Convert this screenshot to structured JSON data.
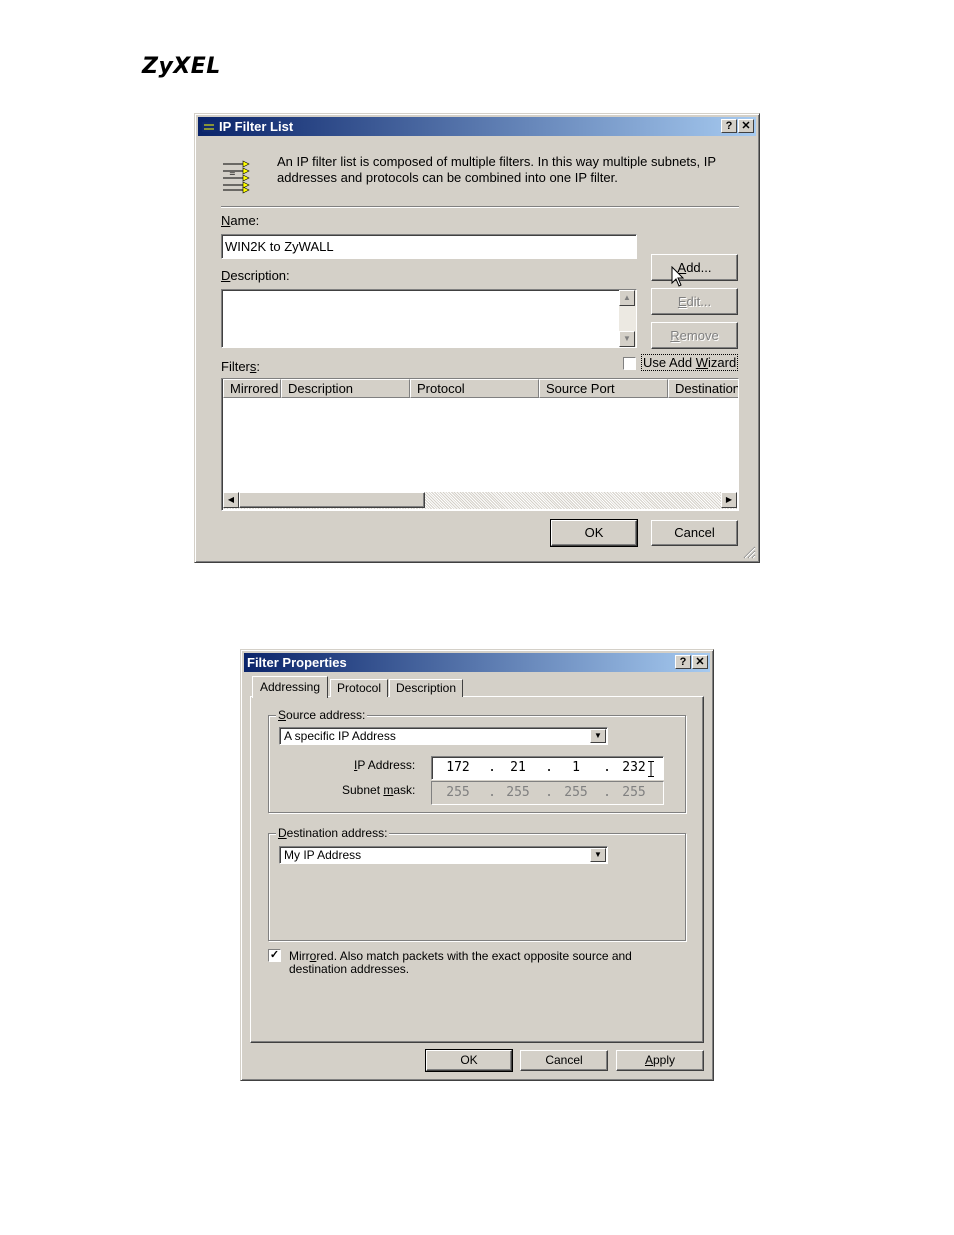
{
  "header": {
    "logo": "ZyXEL"
  },
  "ip_filter_list": {
    "title": "IP Filter List",
    "help_btn": "?",
    "close_btn": "✕",
    "intro": "An IP filter list is composed of multiple filters. In this way multiple subnets, IP addresses and protocols can be combined into one IP filter.",
    "name_label_u": "N",
    "name_label_rest": "ame:",
    "name_value": "WIN2K to ZyWALL",
    "desc_label_u": "D",
    "desc_label_rest": "escription:",
    "desc_value": "",
    "filters_label_a": "Filter",
    "filters_label_u": "s",
    "filters_label_b": ":",
    "add_btn_u": "A",
    "add_btn_rest": "dd...",
    "edit_btn_u": "E",
    "edit_btn_rest": "dit...",
    "remove_btn_u": "R",
    "remove_btn_rest": "emove",
    "wizard_label_a": "Use Add ",
    "wizard_label_u": "W",
    "wizard_label_b": "izard",
    "columns": [
      "Mirrored",
      "Description",
      "Protocol",
      "Source Port",
      "Destination"
    ],
    "ok_btn": "OK",
    "cancel_btn": "Cancel"
  },
  "filter_properties": {
    "title": "Filter Properties",
    "help_btn": "?",
    "close_btn": "✕",
    "tabs": [
      "Addressing",
      "Protocol",
      "Description"
    ],
    "source_legend_u": "S",
    "source_legend_rest": "ource address:",
    "source_value": "A specific IP Address",
    "ip_label_u": "I",
    "ip_label_rest": "P Address:",
    "ip_octets": [
      "172",
      "21",
      "1",
      "232"
    ],
    "mask_label_a": "Subnet ",
    "mask_label_u": "m",
    "mask_label_b": "ask:",
    "mask_octets": [
      "255",
      "255",
      "255",
      "255"
    ],
    "dot": ".",
    "dest_legend_u": "D",
    "dest_legend_rest": "estination address:",
    "dest_value": "My IP Address",
    "mirrored_check": "✓",
    "mirrored_a": "Mirr",
    "mirrored_u": "o",
    "mirrored_b": "red. Also match packets with the exact opposite source and destination addresses.",
    "ok_btn": "OK",
    "cancel_btn": "Cancel",
    "apply_u": "A",
    "apply_rest": "pply"
  }
}
